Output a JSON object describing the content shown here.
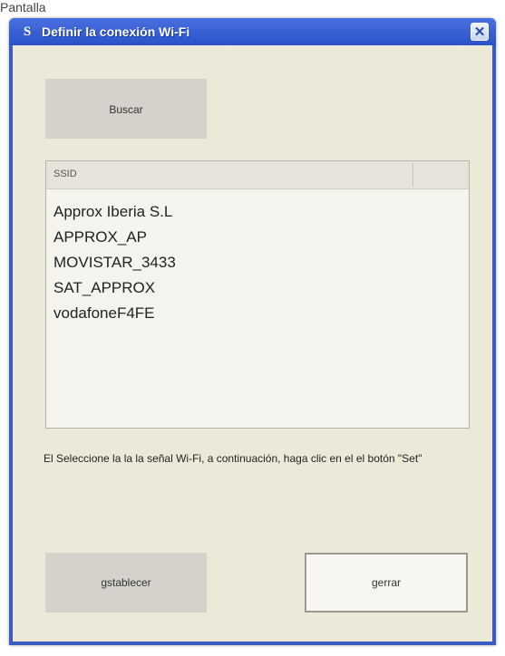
{
  "background": {
    "text": "Pantalla"
  },
  "window": {
    "title": "Definir la conexión Wi-Fi",
    "icon_char": "S",
    "close_glyph": "✕"
  },
  "search_button": {
    "label": "Buscar"
  },
  "network_list": {
    "column_header": "SSID",
    "items": [
      "Approx Iberia S.L",
      "APPROX_AP",
      "MOVISTAR_3433",
      "SAT_APPROX",
      "vodafoneF4FE"
    ]
  },
  "instruction_text": "El Seleccione la la la señal Wi-Fi, a continuación, haga clic en el el botón \"Set\"",
  "reset_button": {
    "label": "gstablecer"
  },
  "close_button": {
    "label": "gerrar"
  },
  "colors": {
    "titlebar": "#2a52c7",
    "client_bg": "#ece9d8",
    "button_bg": "#d4d2cb"
  }
}
